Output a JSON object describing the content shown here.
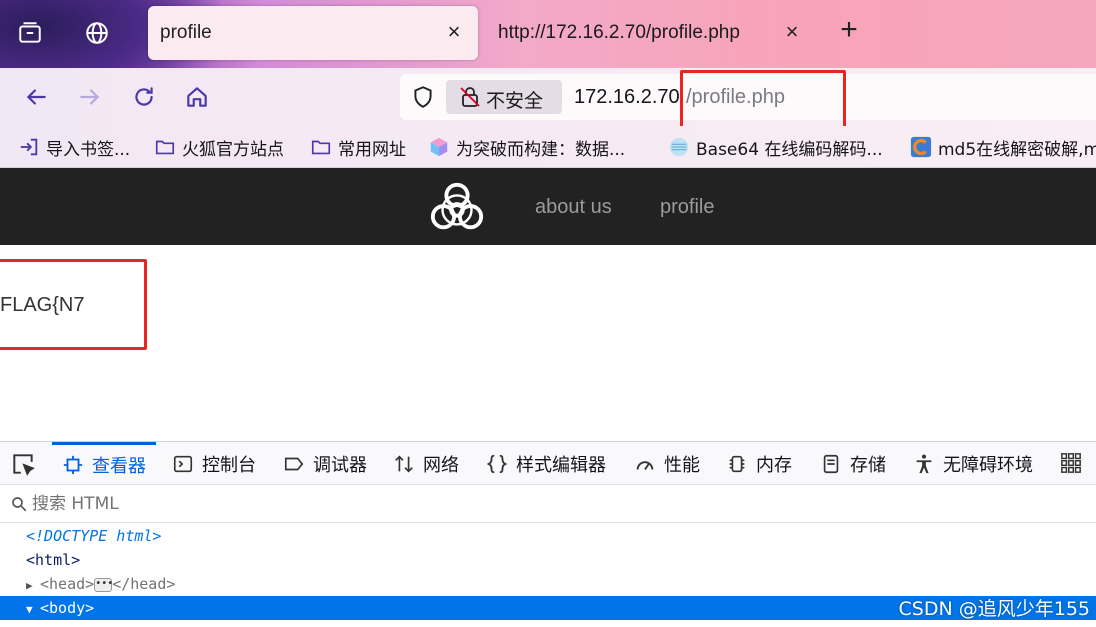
{
  "browser": {
    "tabs": [
      {
        "title": "profile",
        "active": true
      },
      {
        "title": "http://172.16.2.70/profile.php",
        "active": false
      }
    ],
    "new_tab_label": "+",
    "close_glyph": "×",
    "url": {
      "security_label": "不安全",
      "host": "172.16.2.70",
      "path": "/profile.php"
    },
    "bookmarks": [
      {
        "label": "导入书签...",
        "icon": "import-icon"
      },
      {
        "label": "火狐官方站点",
        "icon": "folder-icon"
      },
      {
        "label": "常用网址",
        "icon": "folder-icon"
      },
      {
        "label": "为突破而构建：数据...",
        "icon": "cube-icon"
      },
      {
        "label": "Base64 在线编码解码...",
        "icon": "base64-site-icon"
      },
      {
        "label": "md5在线解密破解,m",
        "icon": "md5-site-icon"
      }
    ]
  },
  "page": {
    "nav": [
      {
        "label": "about us"
      },
      {
        "label": "profile"
      }
    ],
    "flag_text": "FLAG{N7"
  },
  "devtools": {
    "tabs": [
      {
        "label": "查看器",
        "icon": "inspector-icon",
        "active": true
      },
      {
        "label": "控制台",
        "icon": "console-icon"
      },
      {
        "label": "调试器",
        "icon": "debugger-icon"
      },
      {
        "label": "网络",
        "icon": "network-icon"
      },
      {
        "label": "样式编辑器",
        "icon": "style-editor-icon"
      },
      {
        "label": "性能",
        "icon": "performance-icon"
      },
      {
        "label": "内存",
        "icon": "memory-icon"
      },
      {
        "label": "存储",
        "icon": "storage-icon"
      },
      {
        "label": "无障碍环境",
        "icon": "accessibility-icon"
      }
    ],
    "search_placeholder": "搜索 HTML",
    "tree": {
      "doctype": "<!DOCTYPE html>",
      "html_open": "<html>",
      "head_open": "<head>",
      "head_close": "</head>",
      "body_open": "<body>"
    }
  },
  "watermark": "CSDN @追风少年155",
  "colors": {
    "highlight_box": "#e8261d",
    "devtools_accent": "#0061e0",
    "site_header_bg": "#222222"
  }
}
